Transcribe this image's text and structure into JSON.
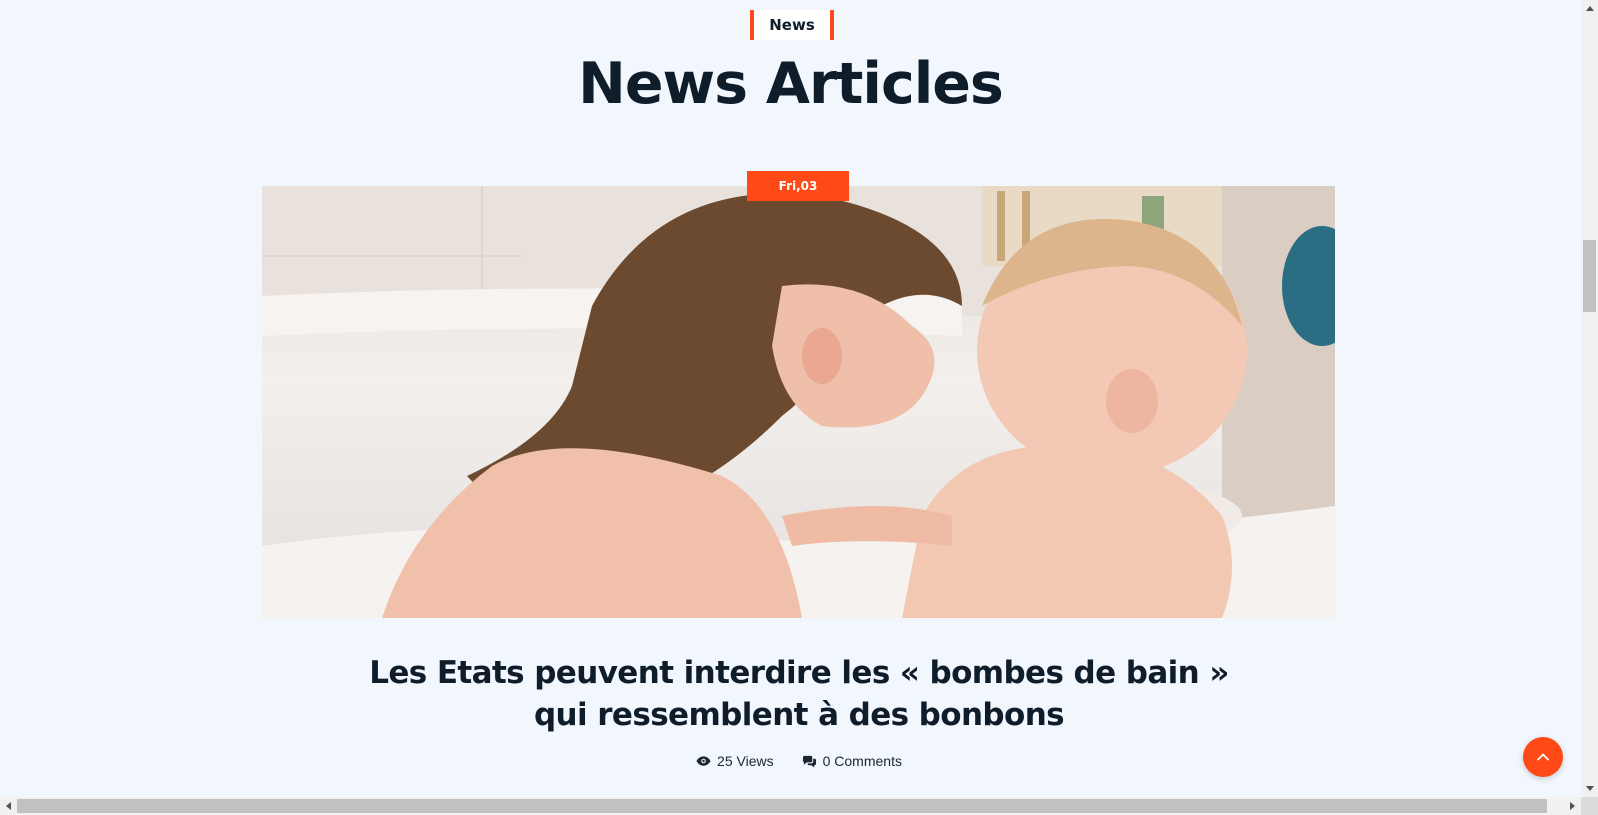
{
  "section": {
    "tag": "News",
    "title": "News Articles"
  },
  "article": {
    "date_badge": "Fri,03",
    "title": "Les Etats peuvent interdire les « bombes de bain » qui ressemblent à des bonbons",
    "views": "25 Views",
    "comments": "0 Comments",
    "image_subject": "girl and baby touching noses in a bubble bath"
  },
  "icons": {
    "views": "eye-icon",
    "comments": "comments-icon",
    "back_to_top": "chevron-up-icon"
  },
  "colors": {
    "accent": "#ff4a17",
    "background": "#f2f6fd",
    "heading": "#0f1d2b"
  }
}
